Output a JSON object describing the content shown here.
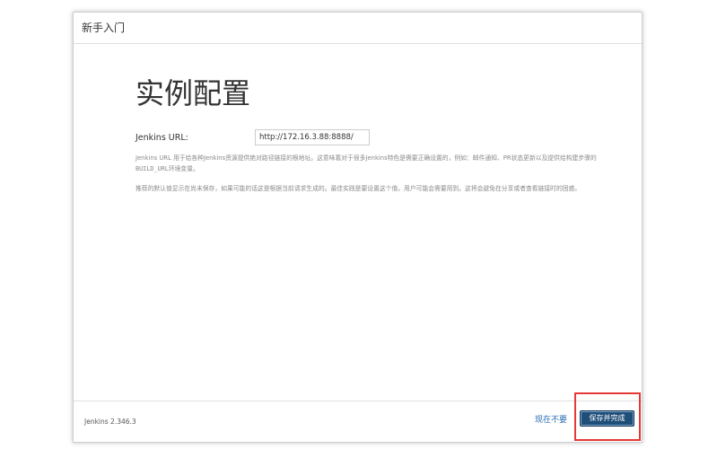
{
  "dialog": {
    "title": "新手入门"
  },
  "main": {
    "heading": "实例配置",
    "jenkins_url_label": "Jenkins URL:",
    "jenkins_url_value": "http://172.16.3.88:8888/",
    "help_line1_part1": "Jenkins URL 用于给各种Jenkins资源提供绝对路径链接的根地址。这意味着对于很多Jenkins特色是需要正确设置的，例如：邮件通知、PR状态更新以及提供给构建步骤的",
    "help_line1_env": "BUILD_URL",
    "help_line1_part2": "环境变量。",
    "help_line2": "推荐的默认值显示在尚未保存，如果可能的话这是根据当前请求生成的。最佳实践是要设置这个值，用户可能会需要用到。这将会避免在分享或者查看链接时的困惑。"
  },
  "footer": {
    "version": "Jenkins 2.346.3",
    "skip_label": "现在不要",
    "save_label": "保存并完成"
  },
  "colors": {
    "save_button": "#1f4e79",
    "link": "#2a6db3",
    "highlight": "#e53935"
  }
}
